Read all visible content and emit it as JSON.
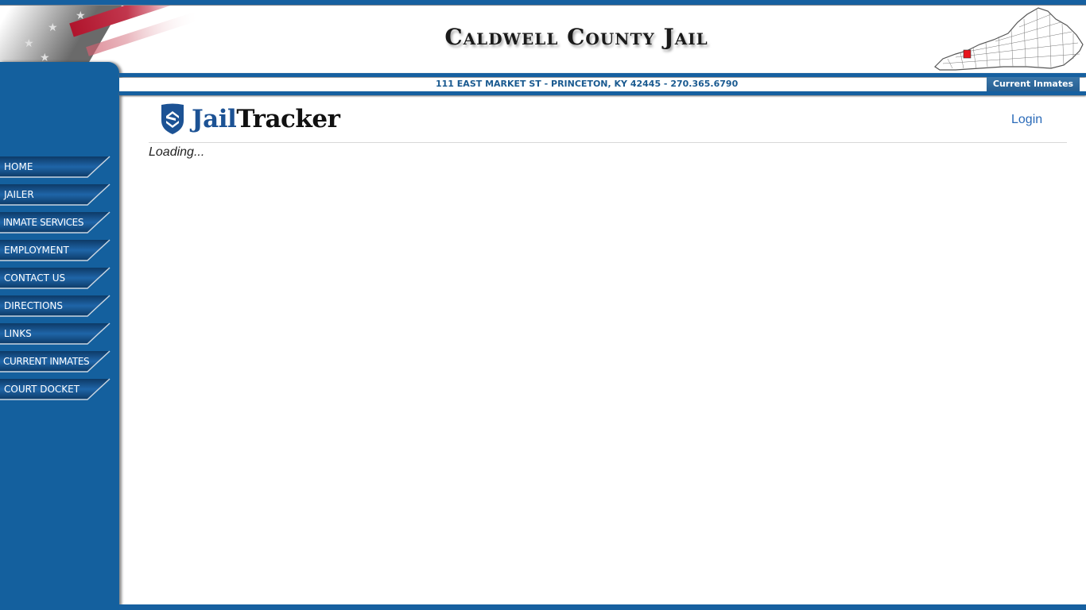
{
  "header": {
    "site_title": "Caldwell County Jail",
    "address": "111 EAST MARKET ST - PRINCETON, KY 42445 - 270.365.6790",
    "current_inmates_button": "Current Inmates",
    "flag_image": "american-flag-banner",
    "map_image": "kentucky-county-map",
    "highlighted_county_color": "#e8141c"
  },
  "sidebar": {
    "items": [
      {
        "label": "HOME"
      },
      {
        "label": "JAILER"
      },
      {
        "label": "INMATE SERVICES"
      },
      {
        "label": "EMPLOYMENT"
      },
      {
        "label": "CONTACT US"
      },
      {
        "label": "DIRECTIONS"
      },
      {
        "label": "LINKS"
      },
      {
        "label": "CURRENT INMATES"
      },
      {
        "label": "COURT DOCKET"
      }
    ]
  },
  "main": {
    "logo": {
      "part1": "Jail",
      "part2": "Tracker",
      "icon": "shield-icon"
    },
    "login_label": "Login",
    "status_text": "Loading..."
  },
  "colors": {
    "brand_blue": "#1660a0",
    "nav_button_blue": "#1b5a92",
    "logo_blue": "#1c5294",
    "link_blue": "#2a6ab8"
  }
}
